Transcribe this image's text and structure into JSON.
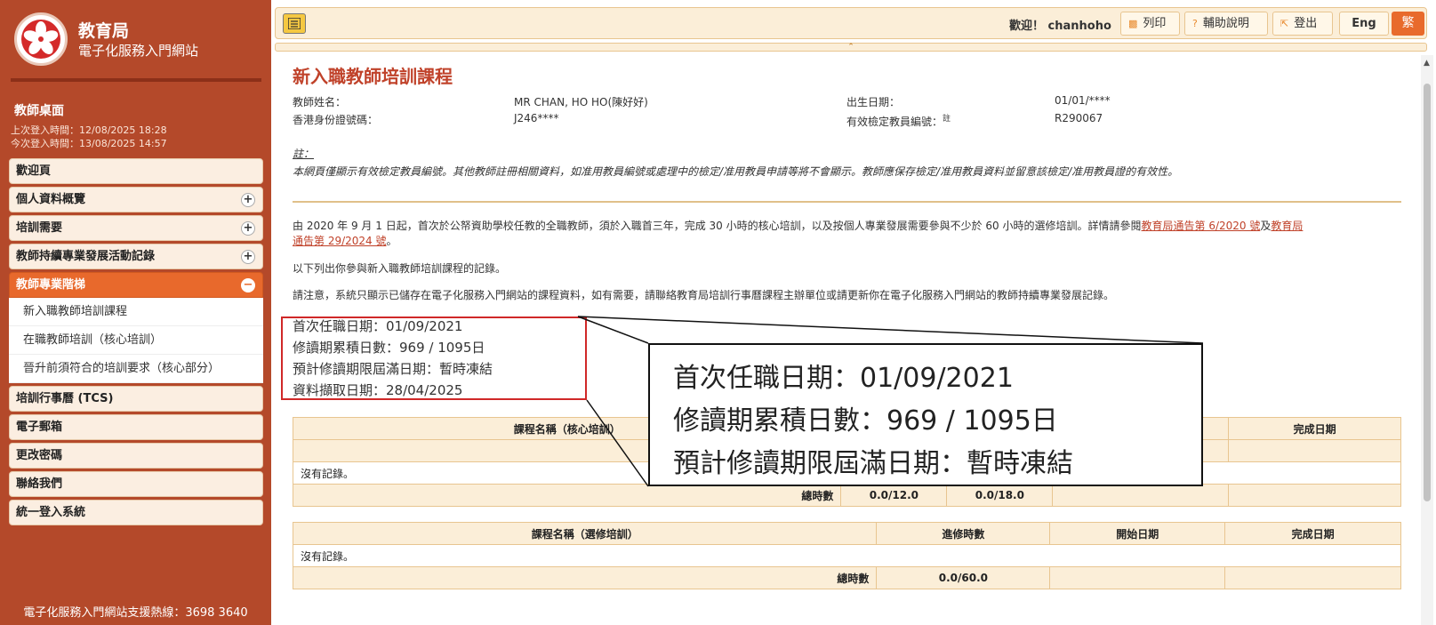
{
  "sidebar": {
    "logo_title": "教育局",
    "logo_subtitle": "電子化服務入門網站",
    "desk_title": "教師桌面",
    "last_login": "上次登入時間：12/08/2025 18:28",
    "this_login": "今次登入時間：13/08/2025 14:57",
    "menu": [
      {
        "label": "歡迎頁",
        "expander": ""
      },
      {
        "label": "個人資料概覽",
        "expander": "+"
      },
      {
        "label": "培訓需要",
        "expander": "+"
      },
      {
        "label": "教師持續專業發展活動記錄",
        "expander": "+"
      },
      {
        "label": "教師專業階梯",
        "expander": "−"
      }
    ],
    "submenu": [
      "新入職教師培訓課程",
      "在職教師培訓（核心培訓）",
      "晉升前須符合的培訓要求（核心部分）"
    ],
    "menu_after": [
      "培訓行事曆 (TCS)",
      "電子郵箱",
      "更改密碼",
      "聯絡我們",
      "統一登入系統"
    ],
    "hotline": "電子化服務入門網站支援熱線：3698 3640"
  },
  "topbar": {
    "welcome": "歡迎！ chanhoho",
    "print_label": "列印",
    "help_label": "輔助說明",
    "logout_label": "登出",
    "lang_en": "Eng",
    "lang_cn": "繁"
  },
  "main": {
    "title": "新入職教師培訓課程",
    "teacher_name_label": "教師姓名：",
    "teacher_name": "MR CHAN, HO HO(陳好好)",
    "dob_label": "出生日期：",
    "dob": "01/01/****",
    "hkid_label": "香港身份證號碼：",
    "hkid": "J246****",
    "reg_label": "有效檢定教員編號：",
    "reg_note_mark": "註",
    "reg_no": "R290067",
    "note_label": "註：",
    "note_text": "本網頁僅顯示有效檢定教員編號。其他教師註冊相關資料，如准用教員編號或處理中的檢定/准用教員申請等將不會顯示。教師應保存檢定/准用教員資料並留意該檢定/准用教員證的有效性。",
    "para1_a": "由 2020 年 9 月 1 日起，首次於公帑資助學校任教的全職教師，須於入職首三年，完成 30 小時的核心培訓，以及按個人專業發展需要參與不少於 60 小時的選修培訓。詳情請參閱",
    "para1_link1": "教育局通告第 6/2020 號",
    "para1_and": "及",
    "para1_link2a": "教育局",
    "para1_link2b": "通告第 29/2024 號",
    "para1_end": "。",
    "para2": "以下列出你參與新入職教師培訓課程的記錄。",
    "para3": "請注意，系統只顯示已儲存在電子化服務入門網站的課程資料，如有需要，請聯絡教育局培訓行事曆課程主辦單位或請更新你在電子化服務入門網站的教師持續專業發展記錄。",
    "first_date": "首次任職日期：01/09/2021",
    "accumulated_days": "修讀期累積日數：969 / 1095日",
    "expiry": "預計修讀期限屆滿日期：暫時凍結",
    "retrieved": "資料擷取日期：28/04/2025"
  },
  "core_table": {
    "headers": [
      "課程名稱（核心培訓）",
      "完成日期"
    ],
    "no_record": "沒有記錄。",
    "total_label": "總時數",
    "total_1": "0.0/12.0",
    "total_2": "0.0/18.0"
  },
  "elective_table": {
    "headers": [
      "課程名稱（選修培訓）",
      "進修時數",
      "開始日期",
      "完成日期"
    ],
    "no_record": "沒有記錄。",
    "total_label": "總時數",
    "total": "0.0/60.0"
  },
  "zoom": {
    "line1": "首次任職日期：01/09/2021",
    "line2": "修讀期累積日數：969 / 1095日",
    "line3": "預計修讀期限屆滿日期：暫時凍結"
  },
  "colors": {
    "sidebar": "#b4492a",
    "accent": "#e8692c",
    "title": "#c0422a",
    "highlight_box": "#d02828"
  }
}
